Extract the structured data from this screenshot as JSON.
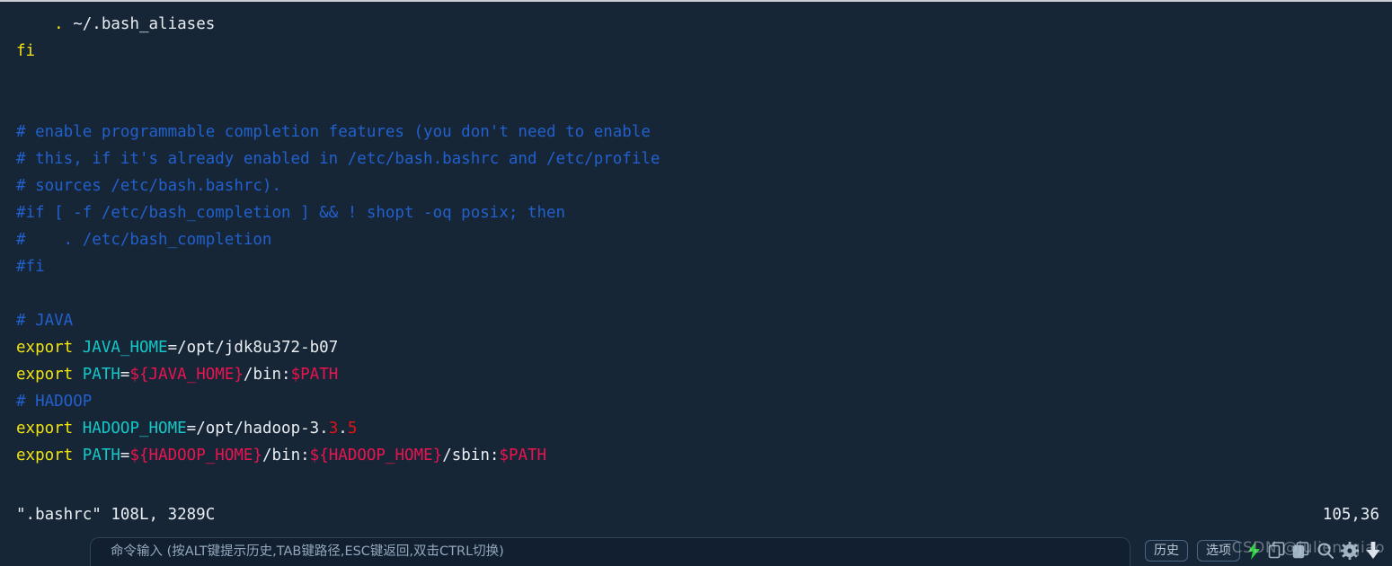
{
  "editor": {
    "lines": [
      {
        "indent": 4,
        "segments": [
          {
            "text": ".",
            "color": "yellow"
          },
          {
            "text": " ~/.bash_aliases",
            "color": "white"
          }
        ]
      },
      {
        "indent": 0,
        "segments": [
          {
            "text": "fi",
            "color": "yellow"
          }
        ]
      },
      {
        "indent": 0,
        "segments": []
      },
      {
        "indent": 0,
        "segments": []
      },
      {
        "indent": 0,
        "segments": [
          {
            "text": "# enable programmable completion features (you don't need to enable",
            "color": "comment"
          }
        ]
      },
      {
        "indent": 0,
        "segments": [
          {
            "text": "# this, if it's already enabled in /etc/bash.bashrc and /etc/profile",
            "color": "comment"
          }
        ]
      },
      {
        "indent": 0,
        "segments": [
          {
            "text": "# sources /etc/bash.bashrc).",
            "color": "comment"
          }
        ]
      },
      {
        "indent": 0,
        "segments": [
          {
            "text": "#if [ -f /etc/bash_completion ] && ! shopt -oq posix; then",
            "color": "comment"
          }
        ]
      },
      {
        "indent": 0,
        "segments": [
          {
            "text": "#    . /etc/bash_completion",
            "color": "comment"
          }
        ]
      },
      {
        "indent": 0,
        "segments": [
          {
            "text": "#fi",
            "color": "comment"
          }
        ]
      },
      {
        "indent": 0,
        "segments": []
      },
      {
        "indent": 0,
        "segments": [
          {
            "text": "# JAVA",
            "color": "comment"
          }
        ]
      },
      {
        "indent": 0,
        "segments": [
          {
            "text": "export ",
            "color": "yellow"
          },
          {
            "text": "JAVA_HOME",
            "color": "cyan"
          },
          {
            "text": "=/opt/jdk8u372-b07",
            "color": "white"
          }
        ]
      },
      {
        "indent": 0,
        "segments": [
          {
            "text": "export ",
            "color": "yellow"
          },
          {
            "text": "PATH",
            "color": "cyan"
          },
          {
            "text": "=",
            "color": "white"
          },
          {
            "text": "${JAVA_HOME}",
            "color": "pink"
          },
          {
            "text": "/bin:",
            "color": "white"
          },
          {
            "text": "$PATH",
            "color": "pink"
          }
        ]
      },
      {
        "indent": 0,
        "segments": [
          {
            "text": "# HADOOP",
            "color": "comment"
          }
        ]
      },
      {
        "indent": 0,
        "segments": [
          {
            "text": "export ",
            "color": "yellow"
          },
          {
            "text": "HADOOP_HOME",
            "color": "cyan"
          },
          {
            "text": "=/opt/hadoop-3.",
            "color": "white"
          },
          {
            "text": "3",
            "color": "red"
          },
          {
            "text": ".",
            "color": "white"
          },
          {
            "text": "5",
            "color": "red"
          }
        ]
      },
      {
        "indent": 0,
        "segments": [
          {
            "text": "export ",
            "color": "yellow"
          },
          {
            "text": "PATH",
            "color": "cyan"
          },
          {
            "text": "=",
            "color": "white"
          },
          {
            "text": "${HADOOP_HOME}",
            "color": "pink"
          },
          {
            "text": "/bin:",
            "color": "white"
          },
          {
            "text": "${HADOOP_HOME}",
            "color": "pink"
          },
          {
            "text": "/sbin:",
            "color": "white"
          },
          {
            "text": "$PATH",
            "color": "pink"
          }
        ]
      }
    ]
  },
  "status": {
    "file_info": "\".bashrc\" 108L, 3289C",
    "cursor_position": "105,36"
  },
  "command_bar": {
    "input_placeholder": "命令输入 (按ALT键提示历史,TAB键路径,ESC键返回,双击CTRL切换)",
    "input_value": "",
    "history_label": "历史",
    "options_label": "选项",
    "icons": [
      "lightning-icon",
      "copy-icon",
      "paste-icon",
      "search-icon",
      "gear-icon",
      "download-icon"
    ]
  },
  "watermark": {
    "text": "CSDN @julien_qiao"
  },
  "colors": {
    "background": "#172636",
    "text": "#e9edf2",
    "keyword_yellow": "#f2e40d",
    "comment_blue": "#2160cd",
    "variable_cyan": "#12c8c8",
    "expansion_pink": "#ea1450",
    "number_red": "#e01414",
    "accent_green": "#29d13a"
  }
}
